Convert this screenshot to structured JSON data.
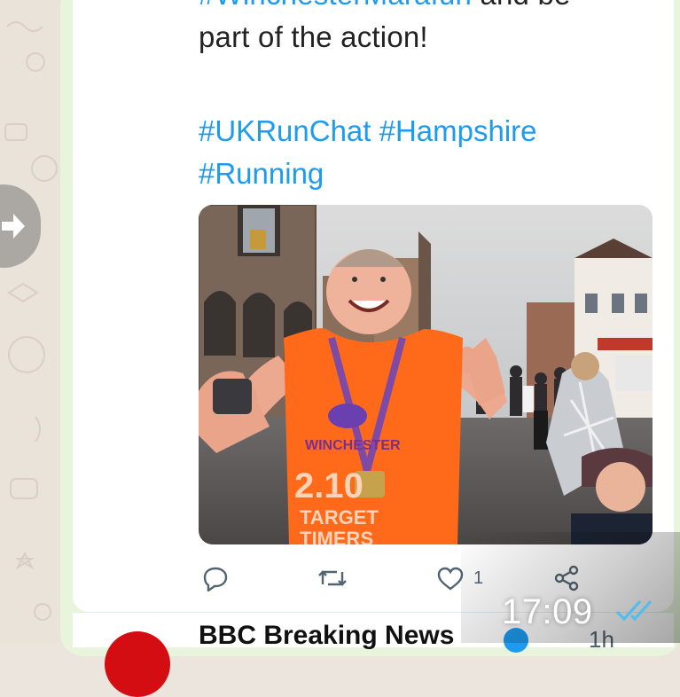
{
  "tweet": {
    "partial_line": "#WinchesterMarafun and be",
    "partial_hashtag": "#WinchesterMarafun",
    "partial_rest": " and be",
    "line2": "part of the action!",
    "hashtags_line1": "#UKRunChat #Hampshire",
    "hashtags_line2": "#Running",
    "vest_brand": "WINCHESTER",
    "vest_time": "2.10",
    "vest_target": "TARGET",
    "vest_timers": "TIMERS"
  },
  "actions": {
    "reply_icon": "reply-icon",
    "retweet_icon": "retweet-icon",
    "like_icon": "heart-icon",
    "like_count": "1",
    "share_icon": "share-icon"
  },
  "next_tweet": {
    "name": "BBC Breaking News",
    "time": "1h"
  },
  "message": {
    "time": "17:09",
    "status_icon": "double-check-icon"
  },
  "colors": {
    "hashtag": "#1d9bf0",
    "bubble": "#e8f5dc",
    "vest": "#ff6a1a",
    "read_ticks": "#53bdeb"
  }
}
